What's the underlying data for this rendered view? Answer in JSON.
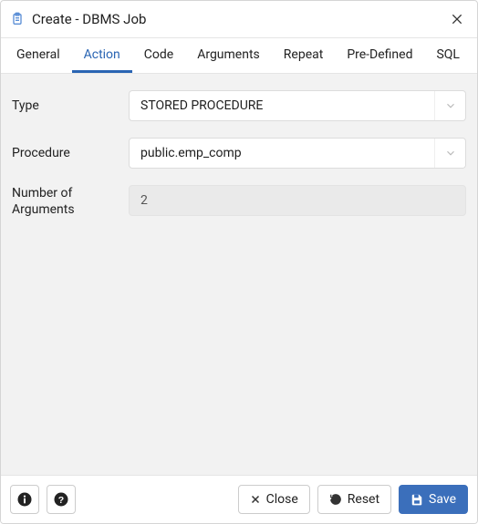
{
  "titlebar": {
    "title": "Create - DBMS Job"
  },
  "tabs": [
    {
      "label": "General",
      "active": false
    },
    {
      "label": "Action",
      "active": true
    },
    {
      "label": "Code",
      "active": false
    },
    {
      "label": "Arguments",
      "active": false
    },
    {
      "label": "Repeat",
      "active": false
    },
    {
      "label": "Pre-Defined",
      "active": false
    },
    {
      "label": "SQL",
      "active": false
    }
  ],
  "form": {
    "type_label": "Type",
    "type_value": "STORED PROCEDURE",
    "procedure_label": "Procedure",
    "procedure_value": "public.emp_comp",
    "numargs_label": "Number of Arguments",
    "numargs_value": "2"
  },
  "footer": {
    "close_label": "Close",
    "reset_label": "Reset",
    "save_label": "Save"
  }
}
